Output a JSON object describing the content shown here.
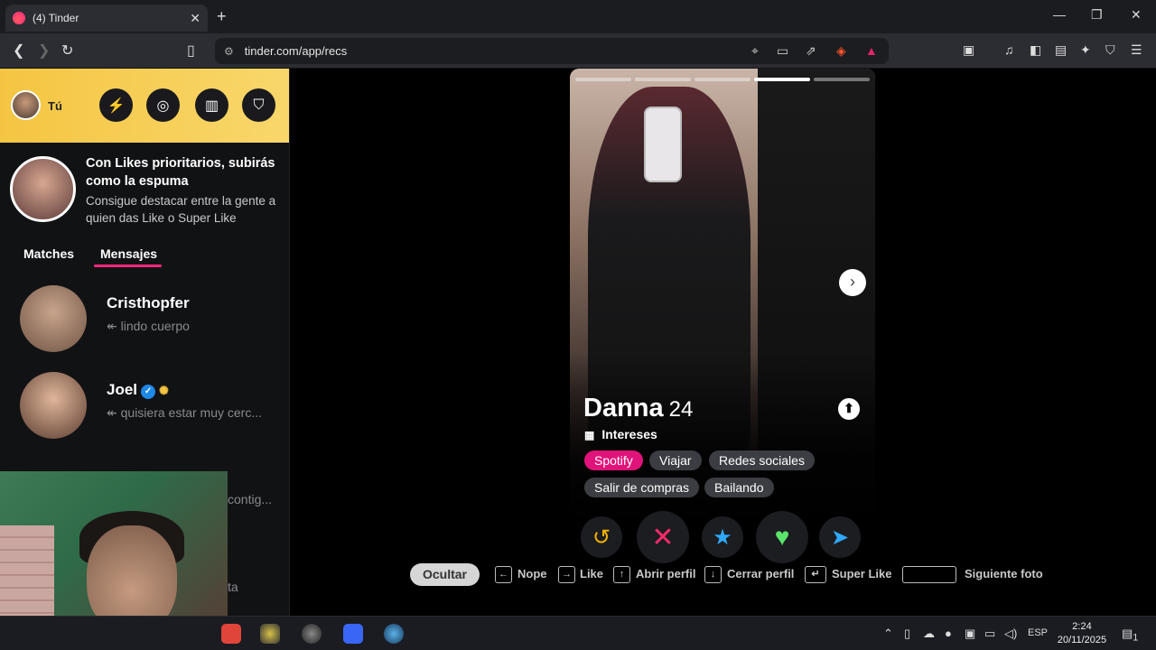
{
  "browser": {
    "tab_title": "(4) Tinder",
    "tab_close": "✕",
    "new_tab": "+",
    "url": "tinder.com/app/recs",
    "window_controls": [
      "—",
      "❐",
      "✕"
    ]
  },
  "sidebar": {
    "me_label": "Tú",
    "header_buttons": [
      "boost-icon",
      "explore-icon",
      "passport-icon",
      "safety-icon"
    ],
    "promo": {
      "title": "Con Likes prioritarios, subirás como la espuma",
      "subtitle": "Consigue destacar entre la gente a quien das Like o Super Like"
    },
    "tabs": [
      "Matches",
      "Mensajes"
    ],
    "active_tab": "Mensajes",
    "conversations": [
      {
        "name": "Cristhopfer",
        "message": "↞ lindo cuerpo"
      },
      {
        "name": "Joel",
        "message": "↞ quisiera estar muy cerc...",
        "verified": true
      },
      {
        "name": "",
        "message": "contig..."
      }
    ],
    "partial_text": "ta"
  },
  "profile": {
    "name": "Danna",
    "age": "24",
    "interests_label": "Intereses",
    "interests": [
      "Spotify",
      "Viajar",
      "Redes sociales",
      "Salir de compras",
      "Bailando"
    ],
    "highlighted_interest": "Spotify",
    "photo_count": 5,
    "active_photo": 3
  },
  "actions": [
    "rewind-icon",
    "nope-icon",
    "superlike-icon",
    "like-icon",
    "boost-send-icon"
  ],
  "shortcuts": {
    "hide_label": "Ocultar",
    "items": [
      {
        "key": "←",
        "label": "Nope"
      },
      {
        "key": "→",
        "label": "Like"
      },
      {
        "key": "↑",
        "label": "Abrir perfil"
      },
      {
        "key": "↓",
        "label": "Cerrar perfil"
      },
      {
        "key": "↵",
        "label": "Super Like"
      },
      {
        "key": "",
        "label": "Siguiente foto"
      }
    ]
  },
  "taskbar": {
    "language": "ESP",
    "time": "2:24",
    "date": "20/11/2025",
    "notification_count": "1"
  },
  "colors": {
    "brand_pink": "#fd267d",
    "gold_header": "#f5c542",
    "nope_red": "#ff2b6b",
    "like_green": "#5be36b",
    "superlike_blue": "#2ea9ff",
    "rewind_yellow": "#f5b400"
  }
}
